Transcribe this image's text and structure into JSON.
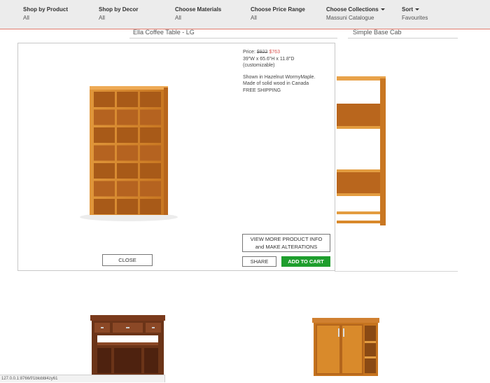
{
  "filters": [
    {
      "label": "Shop by Product",
      "value": "All",
      "has_caret": false
    },
    {
      "label": "Shop by Decor",
      "value": "All",
      "has_caret": false
    },
    {
      "label": "Choose Materials",
      "value": "All",
      "has_caret": false
    },
    {
      "label": "Choose Price Range",
      "value": "All",
      "has_caret": false
    },
    {
      "label": "Choose Collections",
      "value": "Massuni Catalogue",
      "has_caret": true
    },
    {
      "label": "Sort",
      "value": "Favourites",
      "has_caret": true
    }
  ],
  "product_names": {
    "left": "Ella Coffee Table - LG",
    "right": "Simple Base Cab"
  },
  "modal": {
    "price_label": "Price:",
    "price_old": "$922",
    "price_new": "$763",
    "dimensions": "39\"W x 65.6\"H x 11.8\"D",
    "customizable": "(customizable)",
    "shown_in": "Shown in Hazelnut WormyMaple.",
    "made_of": "Made of solid wood in Canada",
    "shipping": "FREE SHIPPING",
    "more_info_line1": "VIEW MORE PRODUCT INFO",
    "more_info_line2": "and MAKE ALTERATIONS",
    "share_label": "SHARE",
    "add_to_cart_label": "ADD TO CART",
    "close_label": "CLOSE"
  },
  "status_url": "127.0.0.1:8766/f/1blobbl4zy61",
  "colors": {
    "accent_green": "#1e9e2d",
    "sale_red": "#d9534f",
    "topbar_bg": "#ececec",
    "wood_light": "#d98a2b",
    "wood_dark": "#6b3418"
  }
}
